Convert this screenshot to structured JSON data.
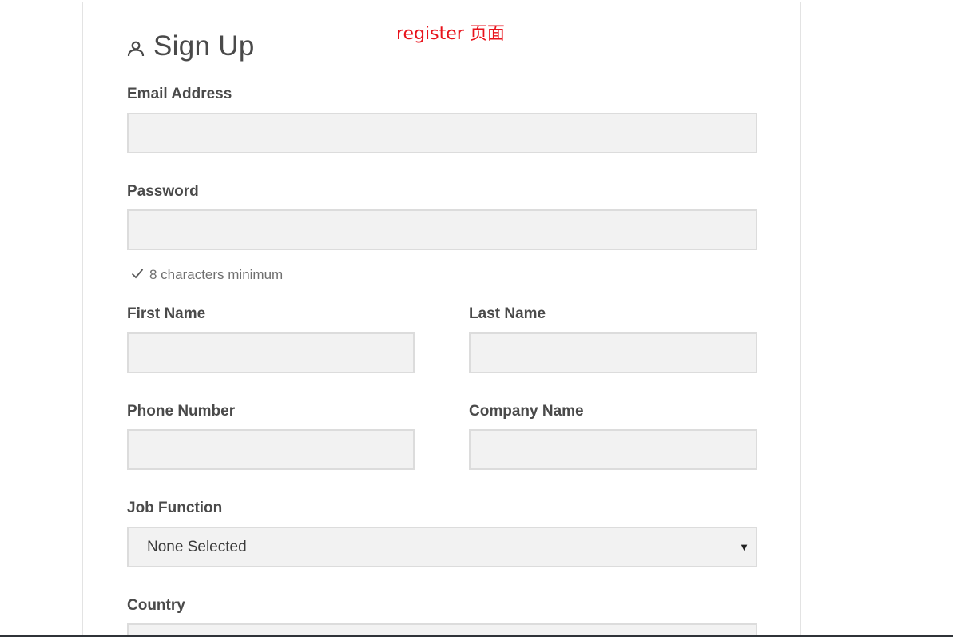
{
  "annotation": "register 页面",
  "header": {
    "title": "Sign Up",
    "icon": "user-icon"
  },
  "form": {
    "email_label": "Email Address",
    "password_label": "Password",
    "password_hint": "8 characters minimum",
    "first_name_label": "First Name",
    "last_name_label": "Last Name",
    "phone_label": "Phone Number",
    "company_label": "Company Name",
    "job_function_label": "Job Function",
    "job_function_value": "None Selected",
    "country_label": "Country"
  },
  "colors": {
    "annotation": "#e8121b",
    "input_bg": "#f2f2f2",
    "input_border": "#dcdcdc",
    "text": "#4a4a4a"
  }
}
